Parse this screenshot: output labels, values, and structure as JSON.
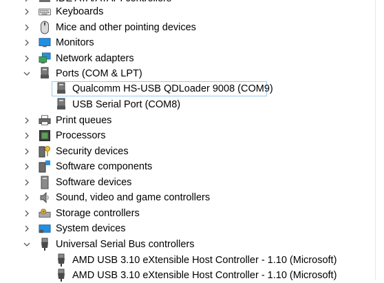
{
  "tree": {
    "top_partial": "IDE ATA/ATAPI controllers",
    "categories": [
      {
        "label": "Keyboards",
        "icon": "keyboard-icon",
        "expanded": false
      },
      {
        "label": "Mice and other pointing devices",
        "icon": "mouse-icon",
        "expanded": false
      },
      {
        "label": "Monitors",
        "icon": "monitor-icon",
        "expanded": false
      },
      {
        "label": "Network adapters",
        "icon": "network-adapter-icon",
        "expanded": false
      },
      {
        "label": "Ports (COM & LPT)",
        "icon": "port-icon",
        "expanded": true,
        "children": [
          {
            "label": "Qualcomm HS-USB QDLoader 9008 (COM9)",
            "icon": "port-icon",
            "selected": true
          },
          {
            "label": "USB Serial Port (COM8)",
            "icon": "port-icon",
            "selected": false
          }
        ]
      },
      {
        "label": "Print queues",
        "icon": "printer-icon",
        "expanded": false
      },
      {
        "label": "Processors",
        "icon": "processor-icon",
        "expanded": false
      },
      {
        "label": "Security devices",
        "icon": "security-device-icon",
        "expanded": false
      },
      {
        "label": "Software components",
        "icon": "software-component-icon",
        "expanded": false
      },
      {
        "label": "Software devices",
        "icon": "software-device-icon",
        "expanded": false
      },
      {
        "label": "Sound, video and game controllers",
        "icon": "speaker-icon",
        "expanded": false
      },
      {
        "label": "Storage controllers",
        "icon": "storage-controller-icon",
        "expanded": false
      },
      {
        "label": "System devices",
        "icon": "system-device-icon",
        "expanded": false
      },
      {
        "label": "Universal Serial Bus controllers",
        "icon": "usb-icon",
        "expanded": true,
        "children": [
          {
            "label": "AMD USB 3.10 eXtensible Host Controller - 1.10 (Microsoft)",
            "icon": "usb-icon"
          },
          {
            "label": "AMD USB 3.10 eXtensible Host Controller - 1.10 (Microsoft)",
            "icon": "usb-icon"
          }
        ]
      }
    ]
  },
  "colors": {
    "selection_border": "#99c9ef",
    "chevron": "#5a5a5a",
    "monitor_blue": "#1e90e6",
    "network_green": "#3aa35a"
  }
}
